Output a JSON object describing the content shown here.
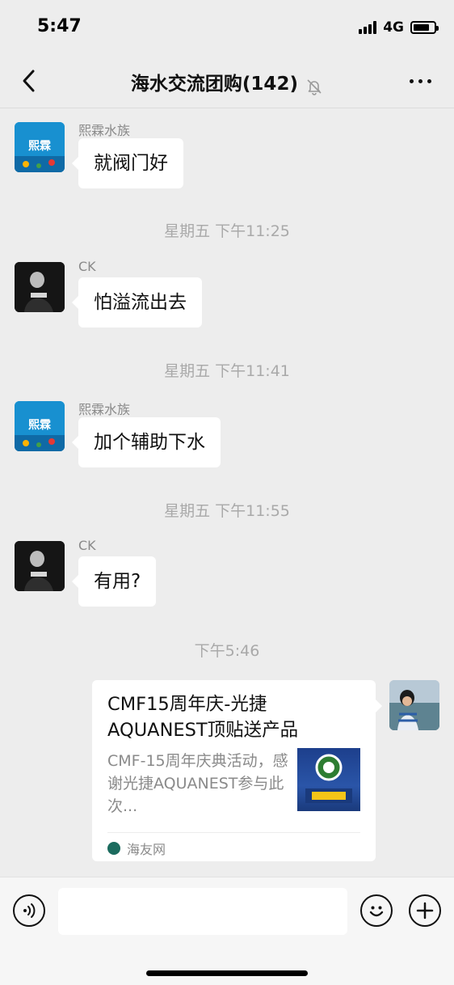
{
  "status_bar": {
    "time": "5:47",
    "network": "4G",
    "battery_level": 0.8
  },
  "header": {
    "title": "海水交流团购(142)",
    "back_icon": "chevron-left-icon",
    "mute_icon": "bell-off-icon",
    "more_icon": "more-dots-icon"
  },
  "messages": [
    {
      "sender": "熙霖水族",
      "text": "就阀门好",
      "avatar_icon": "aquarium-logo-avatar"
    },
    {
      "timestamp": "星期五 下午11:25"
    },
    {
      "sender": "CK",
      "text": "怕溢流出去",
      "avatar_icon": "person-avatar"
    },
    {
      "timestamp": "星期五 下午11:41"
    },
    {
      "sender": "熙霖水族",
      "text": "加个辅助下水",
      "avatar_icon": "aquarium-logo-avatar"
    },
    {
      "timestamp": "星期五 下午11:55"
    },
    {
      "sender": "CK",
      "text": "有用?",
      "avatar_icon": "person-avatar"
    },
    {
      "timestamp": "下午5:46"
    }
  ],
  "link_card": {
    "title": "CMF15周年庆-光捷AQUANEST顶贴送产品",
    "description": "CMF-15周年庆典活动，感谢光捷AQUANEST参与此次...",
    "source": "海友网"
  },
  "colors": {
    "background": "#ededed",
    "bubble": "#ffffff",
    "timestamp": "#a9a9a9",
    "sender": "#8a8a8a"
  },
  "input_bar": {
    "voice_icon": "voice-icon",
    "emoji_icon": "emoji-icon",
    "plus_icon": "plus-icon"
  }
}
